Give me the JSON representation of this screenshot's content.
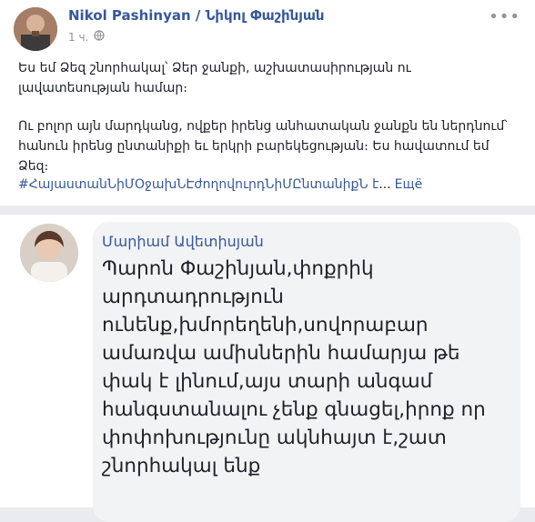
{
  "post": {
    "author": "Nikol Pashinyan / Նիկոլ Փաշինյան",
    "time": "1 ч.",
    "more_label": "•••",
    "paragraph1": "Ես եմ Ձեզ շնորհակալ՝ Ձեր ջանքի, աշխատասիրության ու լավատեսության համար։",
    "paragraph2": "Ու բոլոր այն մարդկանց, ովքեր իրենց անհատական ջանքն են ներդնում՝ հանուն իրենց ընտանիքի եւ երկրի բարեկեցության։ Ես հավատում եմ Ձեզ։",
    "hashtag": "#ՀայաստանՆիՄՕջախՆԷժողովուրդՆիՄԸնտանիքՆ է",
    "ellipsis": "...",
    "see_more": "Ещё"
  },
  "comment": {
    "author": "Մարիամ Ավետիսյան",
    "text": "Պարոն Փաշինյան,փոքրիկ արդտադրություն ունենք,խմորեղենի,սովորաբար ամառվա ամիսներին համարյա թե փակ է լինում,այս տարի անգամ հանգստանալու չենք գնացել,իրոք որ փոփոխությունը ակնհայտ է,շատ շնորհակալ ենք"
  },
  "colors": {
    "link": "#365899",
    "text": "#1d2129",
    "meta": "#90949c",
    "bubble": "#f2f3f5"
  },
  "icons": {
    "privacy": "globe-icon",
    "options": "more-options-icon"
  }
}
